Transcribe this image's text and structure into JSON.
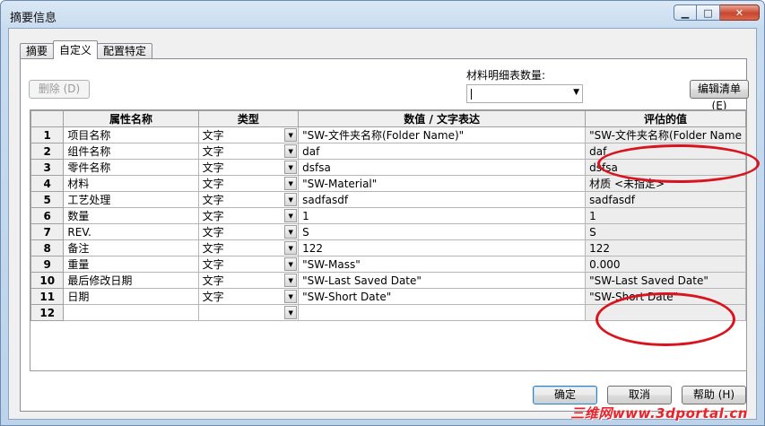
{
  "window": {
    "title": "摘要信息"
  },
  "title_buttons": {
    "minimize": "▁",
    "maximize": "□",
    "close": "✕"
  },
  "tabs": [
    {
      "label": "摘要"
    },
    {
      "label": "自定义"
    },
    {
      "label": "配置特定"
    }
  ],
  "toolbar": {
    "delete_label": "删除 (D)",
    "bom_qty_label": "材料明细表数量:",
    "bom_qty_value": "",
    "edit_list_label": "编辑清单 (E)"
  },
  "grid": {
    "headers": [
      "",
      "属性名称",
      "类型",
      "数值 / 文字表达",
      "评估的值"
    ],
    "rows": [
      {
        "num": "1",
        "name": "项目名称",
        "type": "文字",
        "value": "\"SW-文件夹名称(Folder Name)\"",
        "eval": "\"SW-文件夹名称(Folder Name"
      },
      {
        "num": "2",
        "name": "组件名称",
        "type": "文字",
        "value": "daf",
        "eval": "daf"
      },
      {
        "num": "3",
        "name": "零件名称",
        "type": "文字",
        "value": "dsfsa",
        "eval": "dsfsa"
      },
      {
        "num": "4",
        "name": "材料",
        "type": "文字",
        "value": "\"SW-Material\"",
        "eval": "材质 <未指定>"
      },
      {
        "num": "5",
        "name": "工艺处理",
        "type": "文字",
        "value": "sadfasdf",
        "eval": "sadfasdf"
      },
      {
        "num": "6",
        "name": "数量",
        "type": "文字",
        "value": "1",
        "eval": "1"
      },
      {
        "num": "7",
        "name": "REV.",
        "type": "文字",
        "value": "S",
        "eval": "S"
      },
      {
        "num": "8",
        "name": "备注",
        "type": "文字",
        "value": "122",
        "eval": "122"
      },
      {
        "num": "9",
        "name": "重量",
        "type": "文字",
        "value": "\"SW-Mass\"",
        "eval": "0.000"
      },
      {
        "num": "10",
        "name": "最后修改日期",
        "type": "文字",
        "value": "\"SW-Last Saved Date\"",
        "eval": "\"SW-Last Saved Date\""
      },
      {
        "num": "11",
        "name": "日期",
        "type": "文字",
        "value": "\"SW-Short Date\"",
        "eval": "\"SW-Short Date\""
      },
      {
        "num": "12",
        "name": "",
        "type": "",
        "value": "",
        "eval": ""
      }
    ]
  },
  "footer": {
    "ok_label": "确定",
    "cancel_label": "取消",
    "help_label": "帮助 (H)"
  },
  "watermark": "三维网www.3dportal.cn",
  "colors": {
    "annotation_oval": "#d9141e",
    "watermark": "#e8232a"
  }
}
